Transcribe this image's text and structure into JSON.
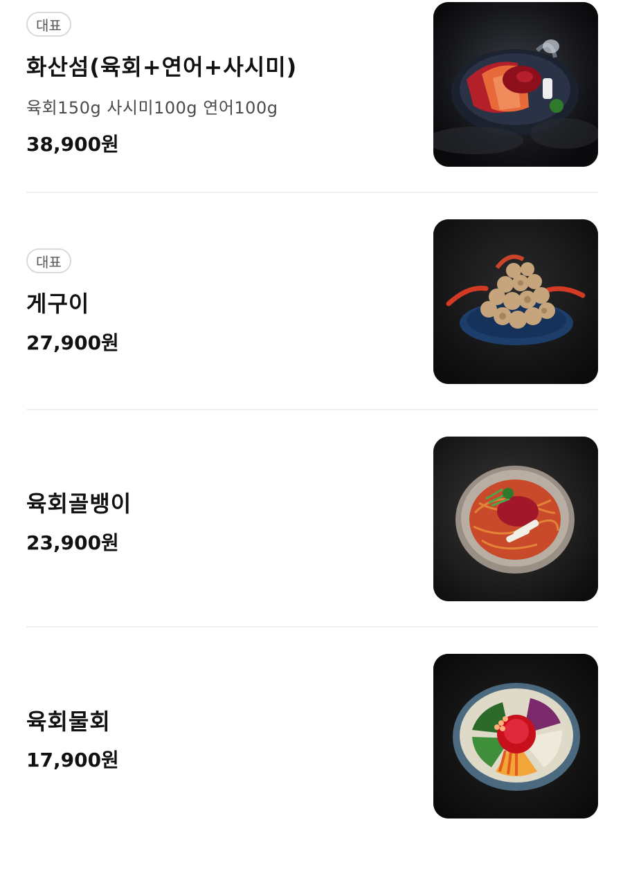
{
  "menu": {
    "items": [
      {
        "badge": "대표",
        "name": "화산섬(육회+연어+사시미)",
        "description": "육회150g 사시미100g 연어100g",
        "price": "38,900원",
        "image": "volcano-island-platter-photo"
      },
      {
        "badge": "대표",
        "name": "게구이",
        "price": "27,900원",
        "image": "grilled-crab-photo"
      },
      {
        "name": "육회골뱅이",
        "price": "23,900원",
        "image": "yukhoe-whelk-noodles-photo"
      },
      {
        "name": "육회물회",
        "price": "17,900원",
        "image": "yukhoe-mulhoe-bowl-photo"
      }
    ]
  },
  "colors": {
    "background": "#ffffff",
    "text": "#111111",
    "badge_border": "#d9d9d9",
    "divider": "#f0f0f0"
  }
}
